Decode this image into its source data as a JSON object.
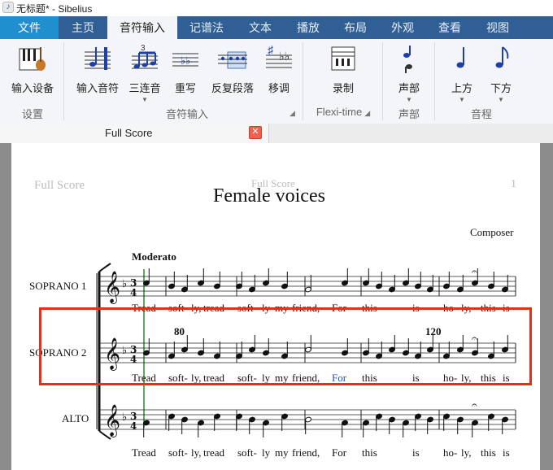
{
  "window": {
    "title": "无标题* - Sibelius"
  },
  "tabs": [
    {
      "label": "文件"
    },
    {
      "label": "主页"
    },
    {
      "label": "音符输入"
    },
    {
      "label": "记谱法"
    },
    {
      "label": "文本"
    },
    {
      "label": "播放"
    },
    {
      "label": "布局"
    },
    {
      "label": "外观"
    },
    {
      "label": "查看"
    },
    {
      "label": "视图"
    }
  ],
  "ribbon": {
    "input_device": "输入设备",
    "input_notes": "输入音符",
    "tuplet": "三连音",
    "rewrite": "重写",
    "repeat": "反复段落",
    "transpose": "移调",
    "record": "录制",
    "voice": "声部",
    "up": "上方",
    "down": "下方",
    "groups": {
      "setup": "设置",
      "note_input": "音符输入",
      "flexi": "Flexi-time",
      "voice": "声部",
      "range": "音程"
    }
  },
  "doc_tab": {
    "label": "Full Score"
  },
  "score": {
    "header_left": "Full Score",
    "header_center": "Full Score",
    "page_number": "1",
    "title": "Female voices",
    "composer": "Composer",
    "tempo": "Moderato",
    "staves": [
      {
        "name": "SOPRANO 1",
        "lyrics": [
          "Tread",
          "soft-",
          "ly,",
          "tread",
          "soft-",
          "ly",
          "my",
          "friend,",
          "For",
          "this",
          "is",
          "ho-",
          "ly,",
          "this",
          "is"
        ]
      },
      {
        "name": "SOPRANO 2",
        "lyrics": [
          "Tread",
          "soft-",
          "ly,",
          "tread",
          "soft-",
          "ly",
          "my",
          "friend,",
          "For",
          "this",
          "is",
          "ho-",
          "ly,",
          "this",
          "is"
        ]
      },
      {
        "name": "ALTO",
        "lyrics": [
          "Tread",
          "soft-",
          "ly,",
          "tread",
          "soft-",
          "ly",
          "my",
          "friend,",
          "For",
          "this",
          "is",
          "ho-",
          "ly,",
          "this",
          "is"
        ]
      }
    ],
    "measure_number_1": "80",
    "measure_number_2": "120"
  }
}
